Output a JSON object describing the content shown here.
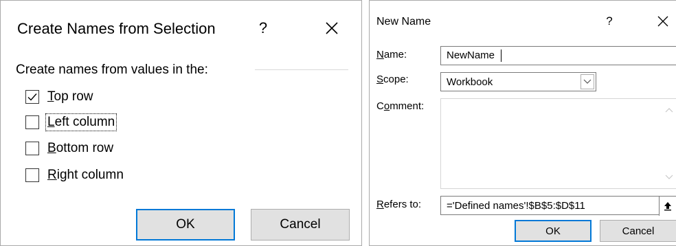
{
  "create_names_dialog": {
    "title": "Create Names from Selection",
    "help": "?",
    "section_label": "Create names from values in the:",
    "options": [
      {
        "label": "Top row",
        "checked": true
      },
      {
        "label": "Left column",
        "checked": false
      },
      {
        "label": "Bottom row",
        "checked": false
      },
      {
        "label": "Right column",
        "checked": false
      }
    ],
    "ok_label": "OK",
    "cancel_label": "Cancel"
  },
  "new_name_dialog": {
    "title": "New Name",
    "help": "?",
    "name_label": "Name:",
    "name_value": "NewName",
    "scope_label": "Scope:",
    "scope_value": "Workbook",
    "comment_label": "Comment:",
    "comment_value": "",
    "refers_to_label": "Refers to:",
    "refers_to_value": "='Defined names'!$B$5:$D$11",
    "ok_label": "OK",
    "cancel_label": "Cancel"
  },
  "colors": {
    "accent": "#0078d7",
    "button_bg": "#e1e1e1"
  }
}
